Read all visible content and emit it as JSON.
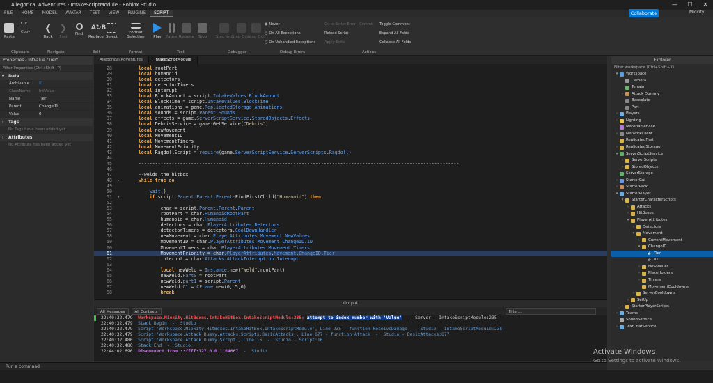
{
  "window": {
    "title": "Allegorical Adventures - IntakeScriptModule - Roblox Studio",
    "minimize": "—",
    "maximize": "☐",
    "close": "✕"
  },
  "menu": {
    "tabs": [
      "FILE",
      "HOME",
      "MODEL",
      "AVATAR",
      "TEST",
      "VIEW",
      "PLUGINS",
      "SCRIPT"
    ],
    "collaborate": "Collaborate",
    "user": "Mioxity"
  },
  "ribbon": {
    "paste": "Paste",
    "cut": "Cut",
    "copy": "Copy",
    "back": "Back",
    "fwd": "Fwd",
    "find": "Find",
    "replace": "Replace",
    "select": "Select",
    "format": "Format Selection",
    "play": "Play",
    "pause": "Pause",
    "resume": "Resume",
    "stop": "Stop",
    "step_into": "Step Into",
    "step_over": "Step Over",
    "step_out": "Step Out",
    "never": "Never",
    "on_all": "On All Exceptions",
    "on_unhandled": "On Unhandled Exceptions",
    "goto_err": "Go to Script Error",
    "commit": "Commit",
    "reload": "Reload Script",
    "apply_edits": "Apply Edits",
    "toggle_comment": "Toggle Comment",
    "expand_folds": "Expand All Folds",
    "collapse_folds": "Collapse All Folds",
    "groups": [
      "Clipboard",
      "Navigate",
      "Edit",
      "Format",
      "Test",
      "Debugger",
      "Debug Errors",
      "Actions"
    ]
  },
  "properties": {
    "title": "Properties - IntValue \"Tier\"",
    "filter": "Filter Properties (Ctrl+Shift+P)",
    "data_section": "Data",
    "rows": [
      {
        "k": "Archivable",
        "v": "☑"
      },
      {
        "k": "ClassName",
        "v": "IntValue"
      },
      {
        "k": "Name",
        "v": "Tier"
      },
      {
        "k": "Parent",
        "v": "ChangeID"
      },
      {
        "k": "Value",
        "v": "0"
      }
    ],
    "tags_section": "Tags",
    "tags_note": "No Tags have been added yet",
    "attr_section": "Attributes",
    "attr_note": "No Attribute has been added yet"
  },
  "editor": {
    "tabs": [
      "Allegorical Adventures",
      "IntakeScriptModule"
    ]
  },
  "output": {
    "title": "Output",
    "filter1": "All Messages",
    "filter2": "All Contexts",
    "search": "Filter...",
    "lines": [
      {
        "t": "22:40:32.479",
        "pre": "Workspace.Mioxity.HitBoxes.IntakeHitBox.IntakeScriptModule:235: ",
        "sel": "attempt to index number with 'Value'",
        "post": "  -  Server - IntakeScriptModule:235"
      },
      {
        "t": "22:40:32.479",
        "txt": "Stack Begin  -  Studio"
      },
      {
        "t": "22:40:32.479",
        "txt": "Script 'Workspace.Mioxity.HitBoxes.IntakeHitBox.IntakeScriptModule', Line 235 - function ReceiveDamage  -  Studio - IntakeScriptModule:235"
      },
      {
        "t": "22:40:32.479",
        "txt": "Script 'Workspace.Attack Dummy.Attacks.Scripts.BasicAttacks', Line 677 - function Attack  -  Studio - BasicAttacks:677"
      },
      {
        "t": "22:40:32.480",
        "txt": "Script 'Workspace.Attack Dummy.Script', Line 16  -  Studio - Script:16"
      },
      {
        "t": "22:40:32.480",
        "txt": "Stack End  -  Studio"
      },
      {
        "t": "22:44:02.696",
        "disc": "Disconnect from ::ffff:127.0.0.1|64667",
        "post": "  -  Studio"
      }
    ]
  },
  "cmd": "Run a command",
  "explorer": {
    "title": "Explorer",
    "filter": "Filter workspace (Ctrl+Shift+X)"
  },
  "activate": {
    "line1": "Activate Windows",
    "line2": "Go to Settings to activate Windows."
  }
}
